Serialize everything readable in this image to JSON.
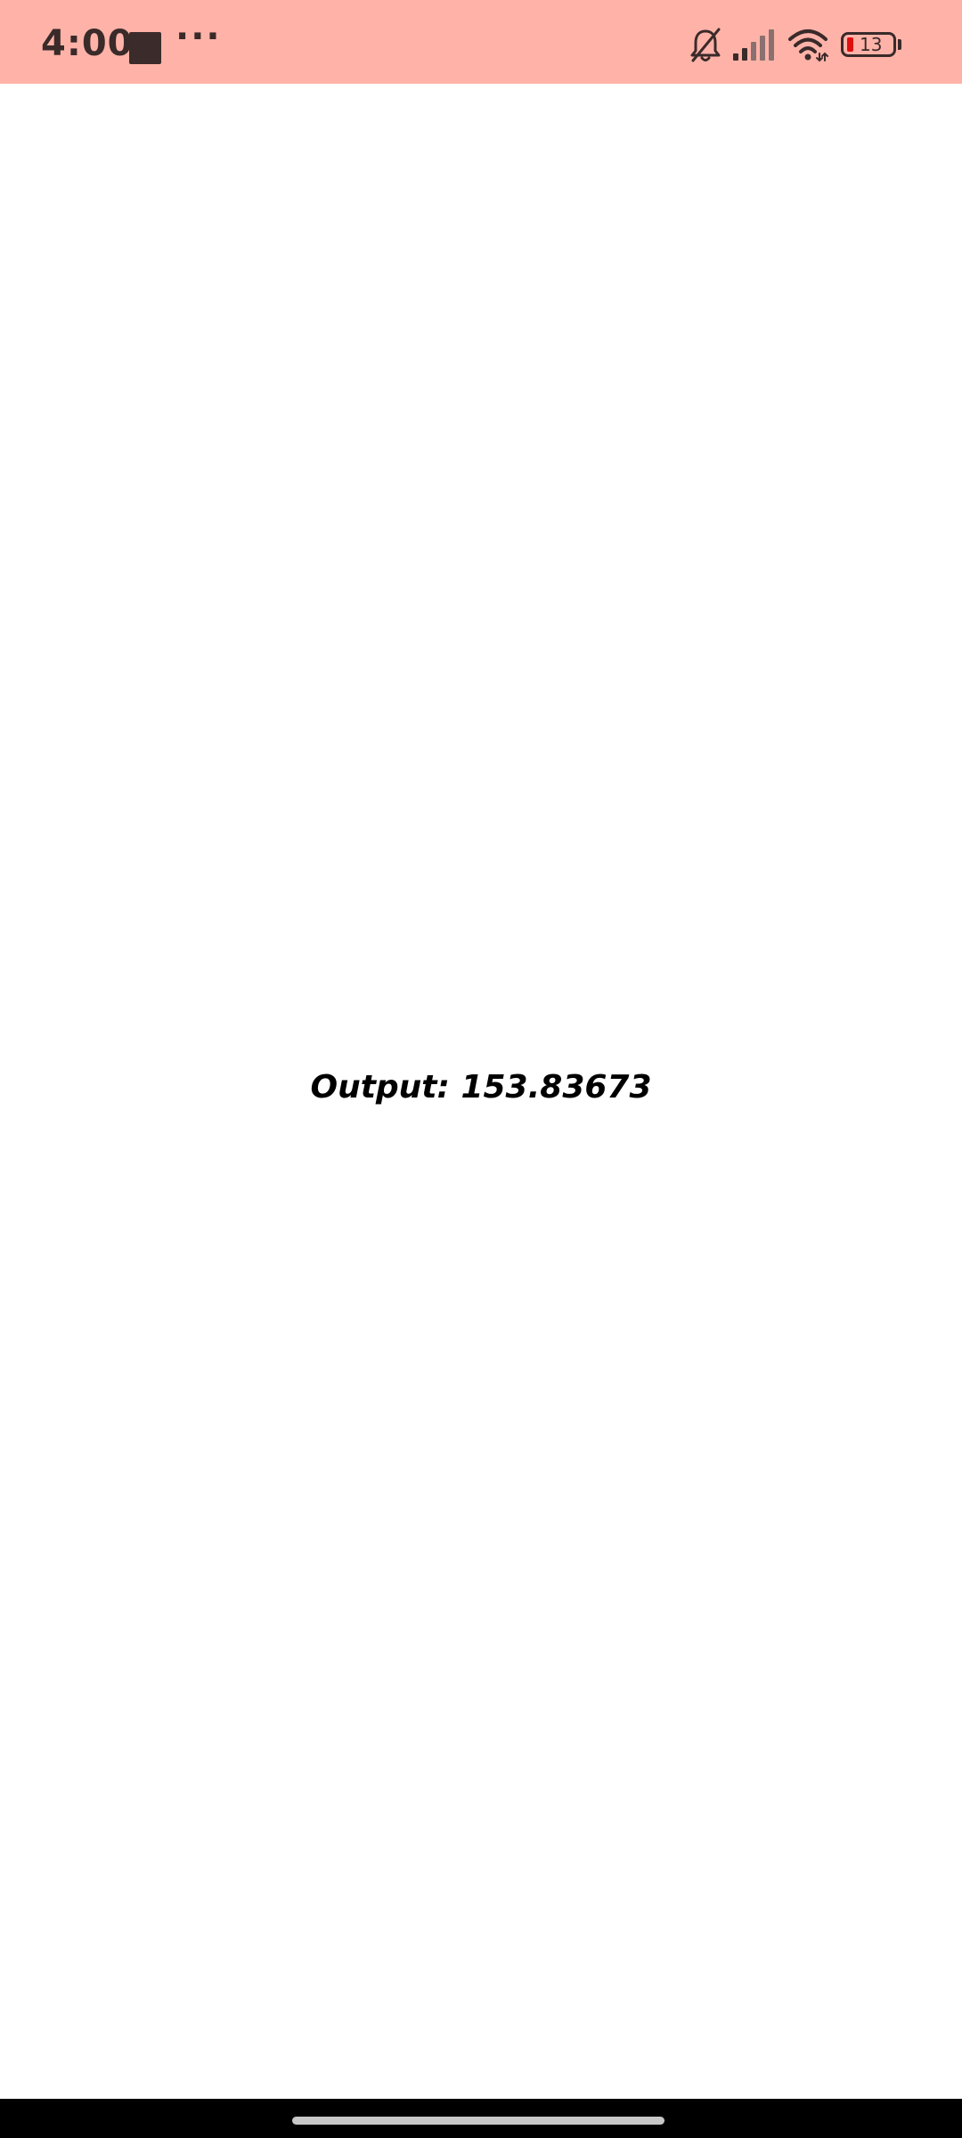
{
  "status_bar": {
    "time": "4:00",
    "more_indicator": "···",
    "battery_level": "13",
    "icons": [
      "bell-off-icon",
      "cell-signal-icon",
      "wifi-icon",
      "battery-icon"
    ],
    "background_color": "#ffb3a8"
  },
  "main": {
    "output_label": "Output: 153.83673"
  },
  "nav_bar": {
    "background_color": "#000000"
  }
}
